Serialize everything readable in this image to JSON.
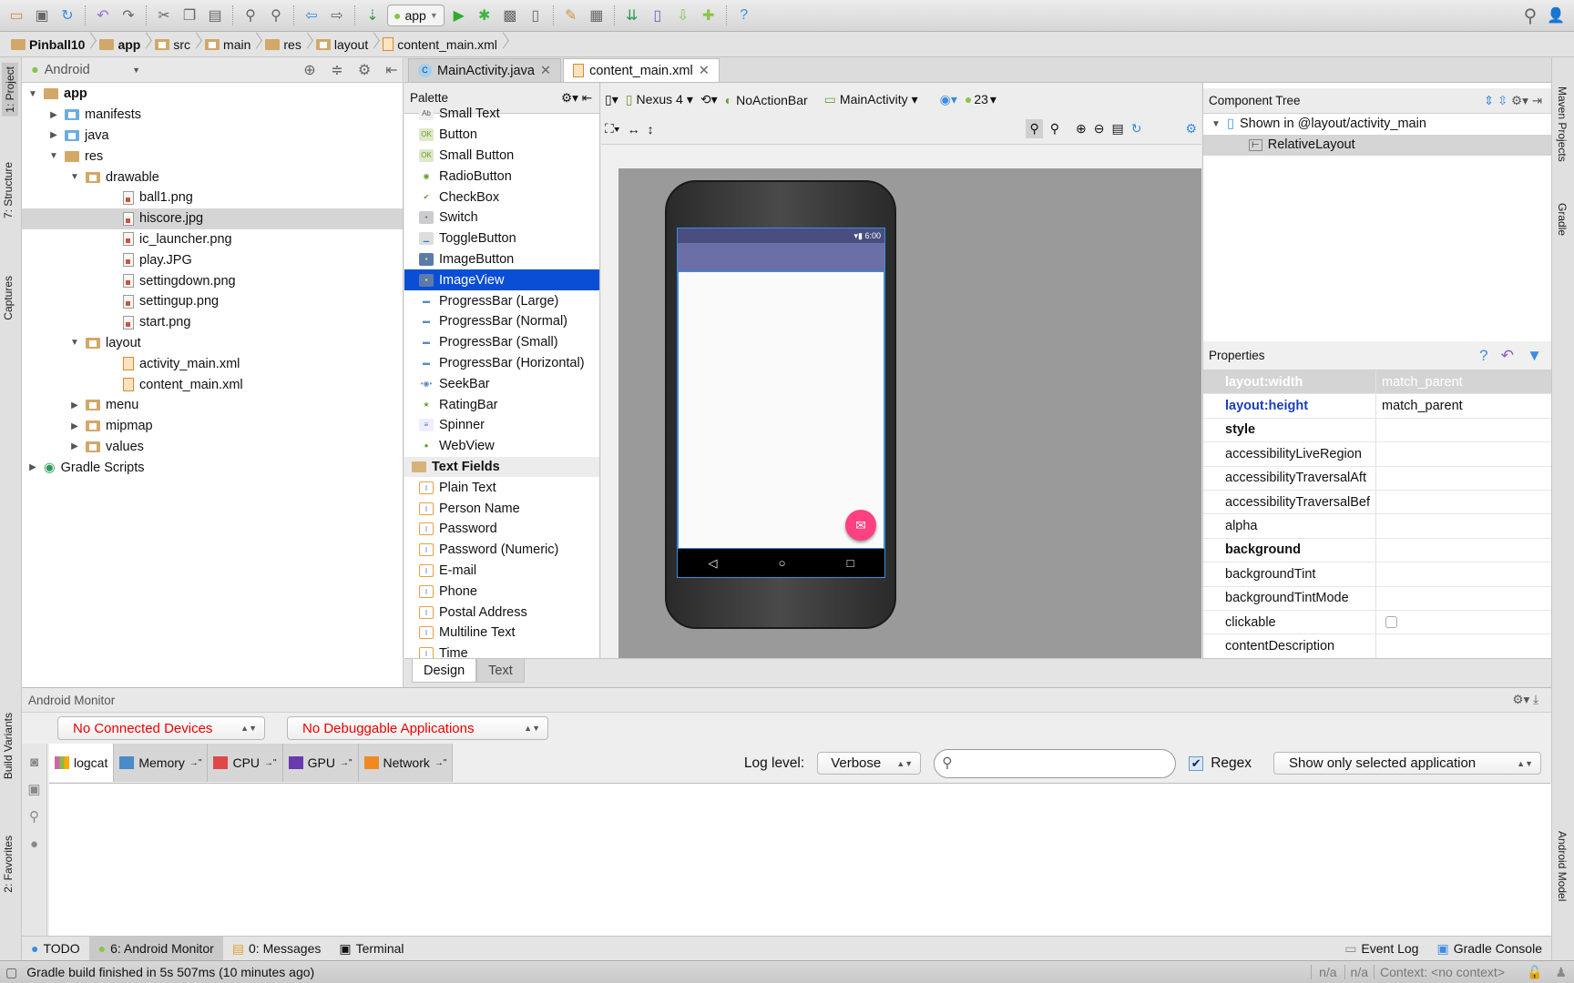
{
  "toolbar": {
    "run_config": "app",
    "icons": [
      "open-folder-icon",
      "save-icon",
      "sync-icon",
      "undo-icon",
      "redo-icon",
      "cut-icon",
      "copy-icon",
      "paste-icon",
      "find-icon",
      "replace-icon",
      "back-icon",
      "forward-icon",
      "make-project-icon",
      "run-icon",
      "debug-icon",
      "attach-debugger-icon",
      "device-monitor-icon",
      "project-structure-icon",
      "sdk-manager-icon",
      "avd-manager-icon",
      "sync-gradle-icon",
      "android-icon",
      "help-icon",
      "search-icon",
      "user-icon"
    ]
  },
  "breadcrumb": [
    "Pinball10",
    "app",
    "src",
    "main",
    "res",
    "layout",
    "content_main.xml"
  ],
  "left_strip": {
    "tabs": [
      "1: Project",
      "7: Structure",
      "Captures",
      "Build Variants",
      "2: Favorites"
    ]
  },
  "right_strip": {
    "tabs": [
      "Maven Projects",
      "Gradle",
      "Android Model"
    ]
  },
  "project": {
    "view_selector": "Android",
    "tree": [
      {
        "label": "app",
        "depth": 0,
        "expanded": true,
        "type": "module"
      },
      {
        "label": "manifests",
        "depth": 1,
        "expanded": false,
        "type": "folder-blue"
      },
      {
        "label": "java",
        "depth": 1,
        "expanded": false,
        "type": "folder-blue"
      },
      {
        "label": "res",
        "depth": 1,
        "expanded": true,
        "type": "folder-res"
      },
      {
        "label": "drawable",
        "depth": 2,
        "expanded": true,
        "type": "folder"
      },
      {
        "label": "ball1.png",
        "depth": 3,
        "type": "img"
      },
      {
        "label": "hiscore.jpg",
        "depth": 3,
        "type": "img",
        "selected": true
      },
      {
        "label": "ic_launcher.png",
        "depth": 3,
        "type": "img"
      },
      {
        "label": "play.JPG",
        "depth": 3,
        "type": "img"
      },
      {
        "label": "settingdown.png",
        "depth": 3,
        "type": "img"
      },
      {
        "label": "settingup.png",
        "depth": 3,
        "type": "img"
      },
      {
        "label": "start.png",
        "depth": 3,
        "type": "img"
      },
      {
        "label": "layout",
        "depth": 2,
        "expanded": true,
        "type": "folder"
      },
      {
        "label": "activity_main.xml",
        "depth": 3,
        "type": "xml"
      },
      {
        "label": "content_main.xml",
        "depth": 3,
        "type": "xml"
      },
      {
        "label": "menu",
        "depth": 2,
        "expanded": false,
        "type": "folder"
      },
      {
        "label": "mipmap",
        "depth": 2,
        "expanded": false,
        "type": "folder"
      },
      {
        "label": "values",
        "depth": 2,
        "expanded": false,
        "type": "folder"
      },
      {
        "label": "Gradle Scripts",
        "depth": 0,
        "expanded": false,
        "type": "gradle"
      }
    ]
  },
  "editor_tabs": [
    {
      "label": "MainActivity.java",
      "active": false
    },
    {
      "label": "content_main.xml",
      "active": true
    }
  ],
  "palette": {
    "title": "Palette",
    "items": [
      {
        "label": "Small Text",
        "icon": "text"
      },
      {
        "label": "Button",
        "icon": "ok"
      },
      {
        "label": "Small Button",
        "icon": "ok"
      },
      {
        "label": "RadioButton",
        "icon": "radio"
      },
      {
        "label": "CheckBox",
        "icon": "check"
      },
      {
        "label": "Switch",
        "icon": "switch"
      },
      {
        "label": "ToggleButton",
        "icon": "toggle"
      },
      {
        "label": "ImageButton",
        "icon": "image"
      },
      {
        "label": "ImageView",
        "icon": "image",
        "selected": true
      },
      {
        "label": "ProgressBar (Large)",
        "icon": "progress"
      },
      {
        "label": "ProgressBar (Normal)",
        "icon": "progress"
      },
      {
        "label": "ProgressBar (Small)",
        "icon": "progress"
      },
      {
        "label": "ProgressBar (Horizontal)",
        "icon": "progress"
      },
      {
        "label": "SeekBar",
        "icon": "seek"
      },
      {
        "label": "RatingBar",
        "icon": "star"
      },
      {
        "label": "Spinner",
        "icon": "spinner"
      },
      {
        "label": "WebView",
        "icon": "globe"
      },
      {
        "label": "Text Fields",
        "group": true
      },
      {
        "label": "Plain Text",
        "icon": "field"
      },
      {
        "label": "Person Name",
        "icon": "field"
      },
      {
        "label": "Password",
        "icon": "field"
      },
      {
        "label": "Password (Numeric)",
        "icon": "field"
      },
      {
        "label": "E-mail",
        "icon": "field"
      },
      {
        "label": "Phone",
        "icon": "field"
      },
      {
        "label": "Postal Address",
        "icon": "field"
      },
      {
        "label": "Multiline Text",
        "icon": "field"
      },
      {
        "label": "Time",
        "icon": "field"
      }
    ]
  },
  "design_toolbar": {
    "device": "Nexus 4",
    "theme": "NoActionBar",
    "activity": "MainActivity",
    "api": "23"
  },
  "phone": {
    "status_time": "6:00",
    "fab_icon": "email-icon",
    "colors": {
      "appbar": "#6b6fa8",
      "fab": "#ff4081"
    }
  },
  "component_tree": {
    "title": "Component Tree",
    "items": [
      "Shown in @layout/activity_main",
      "RelativeLayout"
    ]
  },
  "properties": {
    "title": "Properties",
    "rows": [
      {
        "key": "layout:width",
        "value": "match_parent",
        "style": "selected"
      },
      {
        "key": "layout:height",
        "value": "match_parent",
        "style": "blue"
      },
      {
        "key": "style",
        "value": "",
        "style": "bold"
      },
      {
        "key": "accessibilityLiveRegion",
        "value": ""
      },
      {
        "key": "accessibilityTraversalAft",
        "value": ""
      },
      {
        "key": "accessibilityTraversalBef",
        "value": ""
      },
      {
        "key": "alpha",
        "value": ""
      },
      {
        "key": "background",
        "value": "",
        "style": "bold"
      },
      {
        "key": "backgroundTint",
        "value": ""
      },
      {
        "key": "backgroundTintMode",
        "value": ""
      },
      {
        "key": "clickable",
        "value": "",
        "checkbox": false
      },
      {
        "key": "contentDescription",
        "value": ""
      }
    ]
  },
  "design_tabs": [
    {
      "label": "Design",
      "active": true
    },
    {
      "label": "Text",
      "active": false
    }
  ],
  "monitor": {
    "title": "Android Monitor",
    "device": "No Connected Devices",
    "app": "No Debuggable Applications",
    "tabs": [
      "logcat",
      "Memory",
      "CPU",
      "GPU",
      "Network"
    ],
    "log_level_label": "Log level:",
    "log_level": "Verbose",
    "search_value": "",
    "regex_label": "Regex",
    "regex_checked": true,
    "filter": "Show only selected application"
  },
  "bottom_tabs": {
    "left": [
      {
        "label": "TODO"
      },
      {
        "label": "6: Android Monitor",
        "active": true
      },
      {
        "label": "0: Messages"
      },
      {
        "label": "Terminal"
      }
    ],
    "right": [
      {
        "label": "Event Log"
      },
      {
        "label": "Gradle Console"
      }
    ]
  },
  "status": {
    "message": "Gradle build finished in 5s 507ms (10 minutes ago)",
    "na1": "n/a",
    "na2": "n/a",
    "context": "Context: <no context>"
  }
}
